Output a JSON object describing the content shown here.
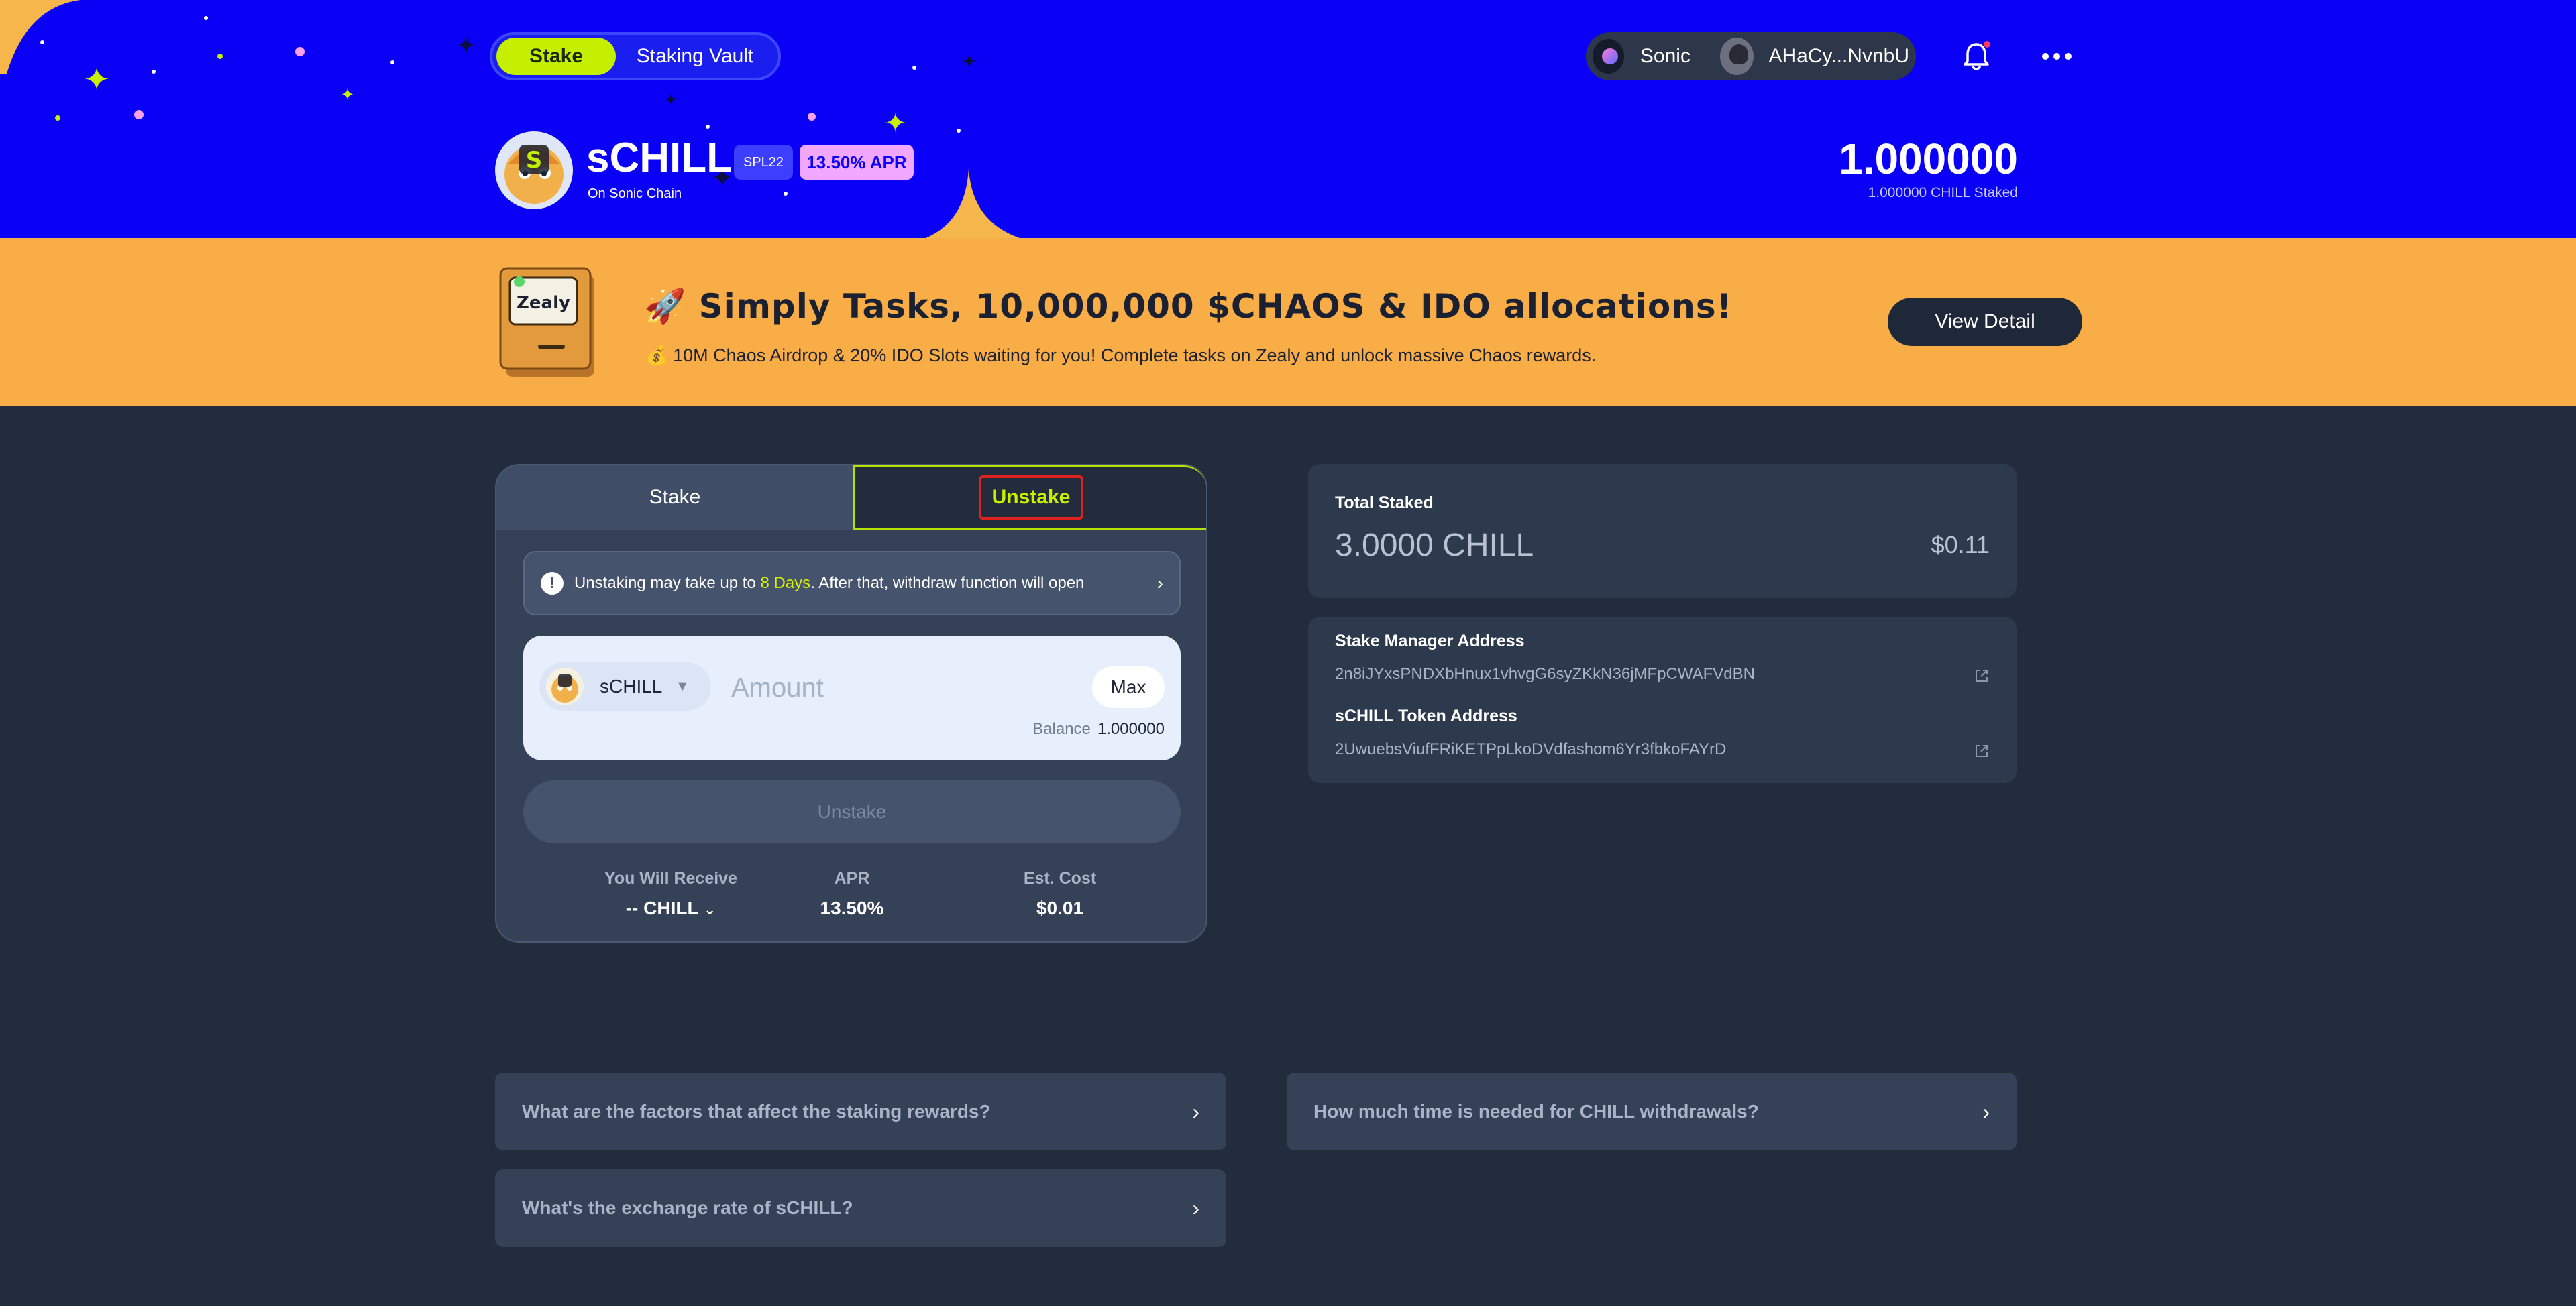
{
  "header": {
    "tabs": [
      {
        "label": "Stake",
        "active": true
      },
      {
        "label": "Staking Vault",
        "active": false
      }
    ],
    "network": {
      "label": "Sonic",
      "icon": "sonic-network-icon"
    },
    "wallet_address": "AHaCy...NvnbU",
    "icons": [
      "bell-icon",
      "more-icon"
    ]
  },
  "token": {
    "name": "sCHILL",
    "chain": "On Sonic Chain",
    "standard_badge": "SPL22",
    "apr_badge": "13.50% APR",
    "staked_balance": "1.000000",
    "staked_caption": "1.000000 CHILL Staked"
  },
  "banner": {
    "title": "🚀 Simply Tasks, 10,000,000 $CHAOS & IDO allocations!",
    "subtitle": "💰 10M Chaos Airdrop & 20% IDO Slots waiting for you! Complete tasks on Zealy and unlock massive Chaos rewards.",
    "button": "View Detail",
    "logo_text": "Zealy"
  },
  "stake_card": {
    "tabs": [
      {
        "label": "Stake",
        "active": false
      },
      {
        "label": "Unstake",
        "active": true
      }
    ],
    "notice": {
      "prefix": "Unstaking may take up to",
      "highlight": "8 Days",
      "suffix": ". After that, withdraw function will open"
    },
    "token_select": "sCHILL",
    "amount_placeholder": "Amount",
    "max_label": "Max",
    "balance_label": "Balance",
    "balance_value": "1.000000",
    "action_button": "Unstake",
    "stats": [
      {
        "label": "You Will Receive",
        "value": "-- CHILL"
      },
      {
        "label": "APR",
        "value": "13.50%"
      },
      {
        "label": "Est. Cost",
        "value": "$0.01"
      }
    ]
  },
  "summary": {
    "total_staked_label": "Total Staked",
    "total_staked_value": "3.0000 CHILL",
    "total_staked_usd": "$0.11",
    "stake_manager_label": "Stake Manager Address",
    "stake_manager_value": "2n8iJYxsPNDXbHnux1vhvgG6syZKkN36jMFpCWAFVdBN",
    "token_address_label": "sCHILL Token Address",
    "token_address_value": "2UwuebsViufFRiKETPpLkoDVdfashom6Yr3fbkoFAYrD"
  },
  "faq": [
    "What are the factors that affect the staking rewards?",
    "How much time is needed for CHILL withdrawals?",
    "What's the exchange rate of sCHILL?"
  ],
  "colors": {
    "hero_blue": "#0900f5",
    "accent_lime": "#c4f000",
    "banner_orange": "#f9ad47",
    "page_bg": "#232c3d",
    "card_bg": "#344157",
    "apr_pink": "#f2a7ff",
    "highlight_red": "#e0221f"
  }
}
